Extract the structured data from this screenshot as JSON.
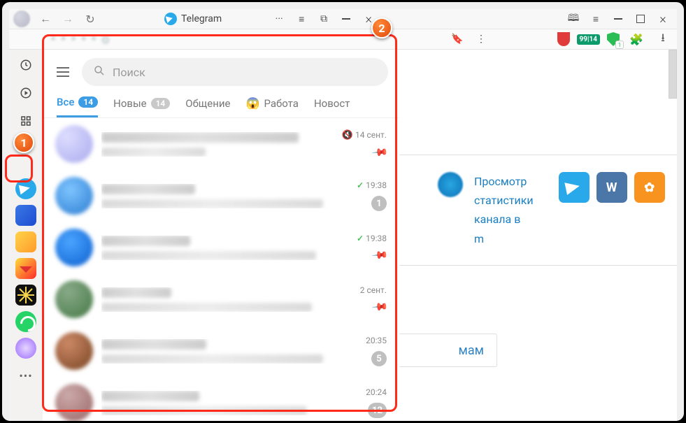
{
  "titlebar": {
    "tab_title": "Telegram",
    "nav_back": "←",
    "nav_fwd": "→",
    "reload": "↻",
    "more": "···",
    "list": "≡",
    "pip": "⧉",
    "min": "—",
    "max": "▢",
    "close": "×",
    "wc_read": "🕮",
    "wc_menu": "≡",
    "wc_min": "—",
    "wc_max": "▢",
    "wc_close": "×"
  },
  "toolbar": {
    "addr_blur": "• • • • •  о",
    "bookmark": "🔖",
    "menu_dots": "⋮",
    "ext_badge_text": "99|14",
    "shield_count": "1",
    "puzzle": "⊞",
    "download": "↓"
  },
  "rail": {
    "clock": "clock",
    "play": "play",
    "grid": "grid",
    "more": "•••"
  },
  "chatpanel": {
    "search_placeholder": "Поиск",
    "tabs": [
      {
        "label": "Все",
        "count": "14",
        "active": true,
        "emoji": ""
      },
      {
        "label": "Новые",
        "count": "14",
        "active": false,
        "emoji": ""
      },
      {
        "label": "Общение",
        "count": "",
        "active": false,
        "emoji": ""
      },
      {
        "label": "Работа",
        "count": "",
        "active": false,
        "emoji": "😱"
      },
      {
        "label": "Новост",
        "count": "",
        "active": false,
        "emoji": ""
      }
    ],
    "chats": [
      {
        "time": "14 сент.",
        "mute": true,
        "pin": true
      },
      {
        "time": "19:38",
        "check": true,
        "badge": "1"
      },
      {
        "time": "19:38",
        "check": true,
        "pin": true
      },
      {
        "time": "2 сент.",
        "pin": true
      },
      {
        "time": "20:35",
        "badge": "5"
      },
      {
        "time": "20:24",
        "badge": "12"
      }
    ]
  },
  "content": {
    "link_line1": "Просмотр",
    "link_line2": "статистики",
    "link_line3": "канала в",
    "link_line4": "m",
    "vk": "W",
    "ok": "✿",
    "bottom_card": "мам"
  },
  "callouts": {
    "c1": "1",
    "c2": "2"
  }
}
